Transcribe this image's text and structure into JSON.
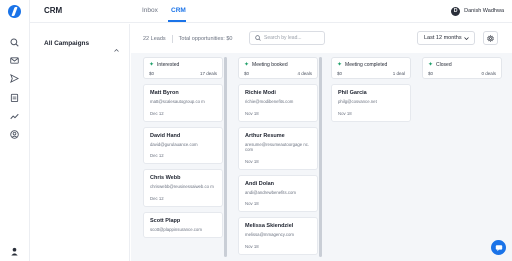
{
  "app": {
    "title": "CRM"
  },
  "header": {
    "tabs": [
      {
        "label": "Inbox"
      },
      {
        "label": "CRM"
      }
    ],
    "user": {
      "initial": "D",
      "name": "Danish Wadhwa"
    }
  },
  "campaigns": {
    "label": "All Campaigns"
  },
  "toolbar": {
    "leads_count": "22 Leads",
    "opportunities": "Total opportunities: $0",
    "search_placeholder": "Search by lead...",
    "period": "Last 12 months"
  },
  "columns": [
    {
      "name": "Interested",
      "amount": "$0",
      "deals": "17 deals",
      "cards": [
        {
          "name": "Matt Byron",
          "email": "matt@scalesautogroup.co m",
          "date": "Dec 12"
        },
        {
          "name": "David Hand",
          "email": "david@gurulauance.com",
          "date": "Dec 12"
        },
        {
          "name": "Chris Webb",
          "email": "chriswebb@reusinessaiweb.co m",
          "date": "Dec 12"
        },
        {
          "name": "Scott Plapp",
          "email": "scott@plappinsurance.com",
          "date": ""
        }
      ]
    },
    {
      "name": "Meeting booked",
      "amount": "$0",
      "deals": "4 deals",
      "cards": [
        {
          "name": "Richie Modi",
          "email": "richie@modibenefits.com",
          "date": "Nov 18"
        },
        {
          "name": "Arthur Resume",
          "email": "aresume@resumeautoorgage nc.com",
          "date": "Nov 18"
        },
        {
          "name": "Andi Dolan",
          "email": "andi@andrewbenefits.com",
          "date": "Nov 18"
        },
        {
          "name": "Melissa Skiendziel",
          "email": "melissa@mmagency.com",
          "date": "Nov 18"
        }
      ]
    },
    {
      "name": "Meeting completed",
      "amount": "$0",
      "deals": "1 deal",
      "cards": [
        {
          "name": "Phil Garcia",
          "email": "philg@cosvance.net",
          "date": "Nov 18"
        }
      ]
    },
    {
      "name": "Closed",
      "amount": "$0",
      "deals": "0 deals",
      "cards": []
    }
  ],
  "colors": {
    "accent": "#1a73e8",
    "status": "#22a06b",
    "board_bg": "#f4f6f9"
  },
  "icons": [
    "logo-icon",
    "search-icon",
    "mail-icon",
    "send-icon",
    "clipboard-icon",
    "trend-icon",
    "user-circle-icon",
    "person-icon",
    "chevron-down-icon",
    "gear-icon",
    "chat-icon"
  ]
}
